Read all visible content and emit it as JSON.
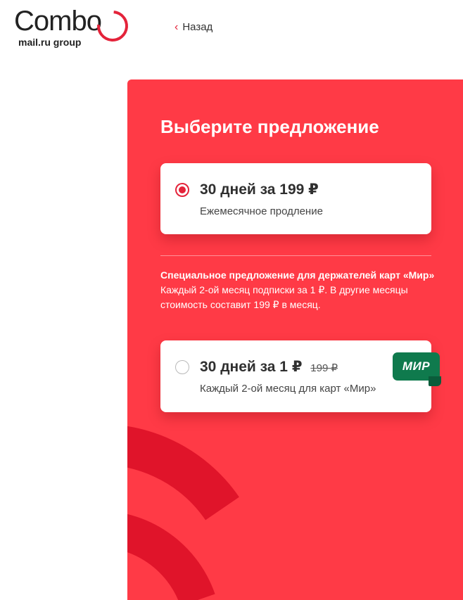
{
  "header": {
    "logo_word": "Combo",
    "logo_sub": "mail.ru group",
    "back_label": "Назад"
  },
  "offer_panel": {
    "title": "Выберите предложение",
    "plans": [
      {
        "title": "30 дней за 199 ₽",
        "subtitle": "Ежемесячное продление",
        "selected": true
      },
      {
        "title": "30 дней за 1 ₽",
        "old_price": "199 ₽",
        "subtitle": "Каждый 2-ой месяц для карт «Мир»",
        "selected": false,
        "badge": "МИР"
      }
    ],
    "promo": {
      "heading": "Специальное предложение для держателей карт «Мир»",
      "text": "Каждый 2-ой месяц подписки за 1 ₽. В другие месяцы стоимость составит 199 ₽ в месяц."
    }
  },
  "colors": {
    "brand_red": "#ff3a46",
    "accent_red": "#e4233a",
    "mir_green": "#0f7a4d"
  }
}
